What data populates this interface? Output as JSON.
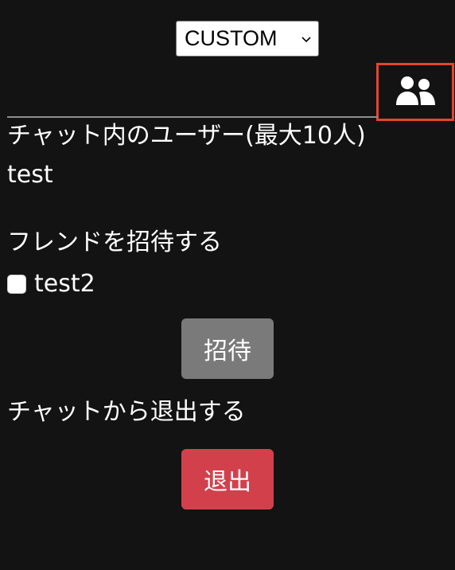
{
  "header": {
    "theme_select": {
      "value": "CUSTOM",
      "icon": "chevron-down-icon"
    },
    "users_button": {
      "icon": "users-icon",
      "highlight_color": "#e3452f"
    }
  },
  "members": {
    "heading": "チャット内のユーザー(最大10人)",
    "users": [
      "test"
    ]
  },
  "invite": {
    "heading": "フレンドを招待する",
    "friends": [
      {
        "label": "test2",
        "checked": false
      }
    ],
    "button_label": "招待",
    "button_color": "#7a7a7a"
  },
  "leave": {
    "heading": "チャットから退出する",
    "button_label": "退出",
    "button_color": "#d2414b"
  }
}
